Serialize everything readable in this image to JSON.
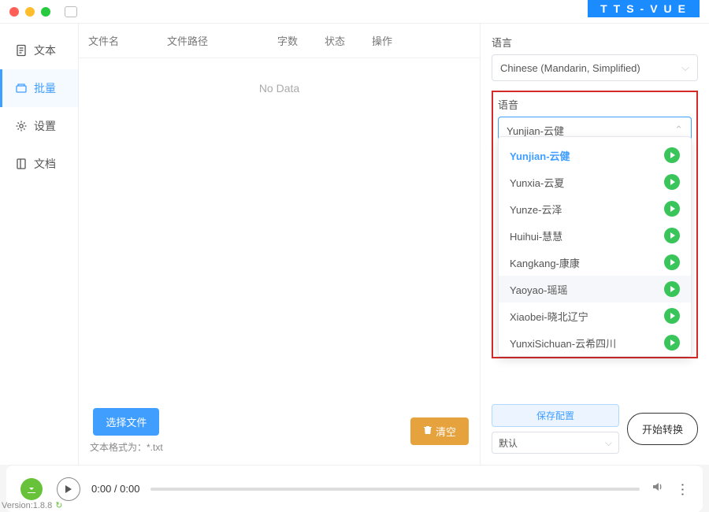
{
  "brand": "TTS-VUE",
  "sidebar": {
    "items": [
      {
        "label": "文本"
      },
      {
        "label": "批量"
      },
      {
        "label": "设置"
      },
      {
        "label": "文档"
      }
    ]
  },
  "table": {
    "headers": [
      "文件名",
      "文件路径",
      "字数",
      "状态",
      "操作"
    ],
    "empty": "No Data"
  },
  "center_foot": {
    "select_file": "选择文件",
    "hint_prefix": "文本格式为：",
    "hint_ext": "*.txt",
    "clear": "清空"
  },
  "right": {
    "lang_label": "语言",
    "lang_value": "Chinese (Mandarin, Simplified)",
    "voice_label": "语音",
    "voice_value": "Yunjian-云健",
    "options": [
      {
        "label": "Yunjian-云健",
        "selected": true
      },
      {
        "label": "Yunxia-云夏"
      },
      {
        "label": "Yunze-云泽"
      },
      {
        "label": "Huihui-慧慧"
      },
      {
        "label": "Kangkang-康康"
      },
      {
        "label": "Yaoyao-瑶瑶",
        "hover": true
      },
      {
        "label": "Xiaobei-晓北辽宁"
      },
      {
        "label": "YunxiSichuan-云希四川"
      }
    ],
    "save_config": "保存配置",
    "preset": "默认",
    "start": "开始转换"
  },
  "player": {
    "time": "0:00 / 0:00"
  },
  "version": "Version:1.8.8"
}
